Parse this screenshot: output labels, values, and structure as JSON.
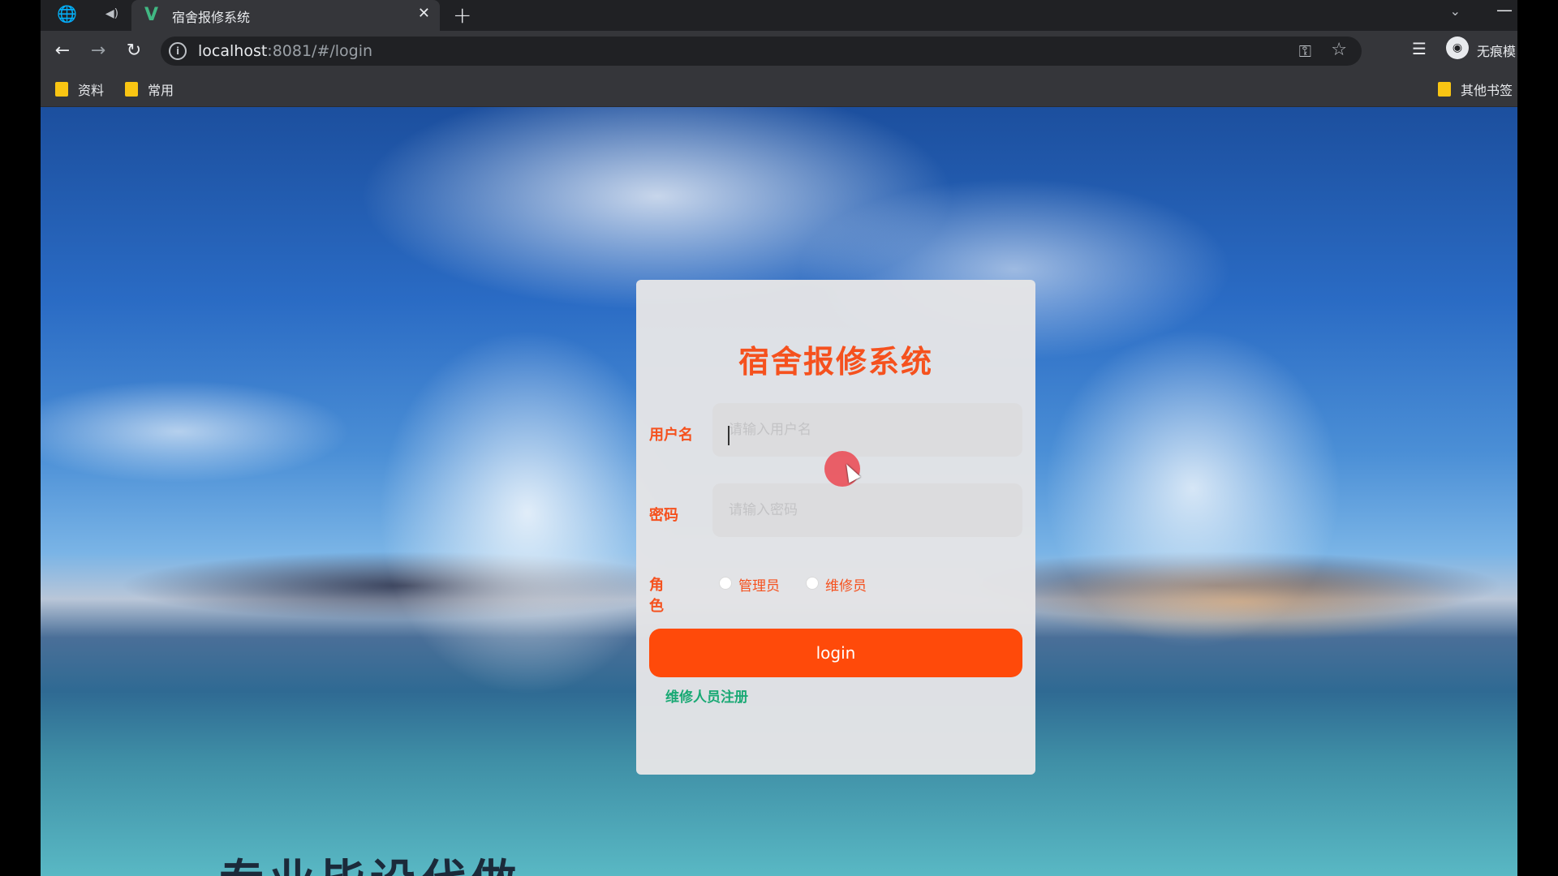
{
  "browser": {
    "tab": {
      "title": "宿舍报修系统",
      "close": "✕"
    },
    "new_tab": "+",
    "url": {
      "host": "localhost",
      "path": ":8081/#/login"
    },
    "profile_label": "无痕模",
    "bookmarks": [
      {
        "label": "资料"
      },
      {
        "label": "常用"
      }
    ],
    "other_bookmarks": "其他书签"
  },
  "login": {
    "title": "宿舍报修系统",
    "username": {
      "label": "用户名",
      "placeholder": "请输入用户名",
      "value": ""
    },
    "password": {
      "label": "密码",
      "placeholder": "请输入密码",
      "value": ""
    },
    "role": {
      "label": "角色",
      "options": [
        {
          "label": "管理员",
          "selected": false
        },
        {
          "label": "维修员",
          "selected": false
        }
      ]
    },
    "submit_label": "login",
    "register_link": "维修人员注册"
  },
  "background_caption": "专业毕设代做",
  "colors": {
    "accent": "#f5511e",
    "button": "#ff4a0a",
    "link": "#19a974",
    "vue_green": "#41b883",
    "bookmark_folder": "#f9c513"
  },
  "icons": [
    "globe-icon",
    "speaker-icon",
    "vue-favicon",
    "close-icon",
    "plus-icon",
    "back-icon",
    "forward-icon",
    "reload-icon",
    "info-icon",
    "key-icon",
    "star-icon",
    "reading-list-icon",
    "incognito-icon",
    "folder-icon"
  ]
}
